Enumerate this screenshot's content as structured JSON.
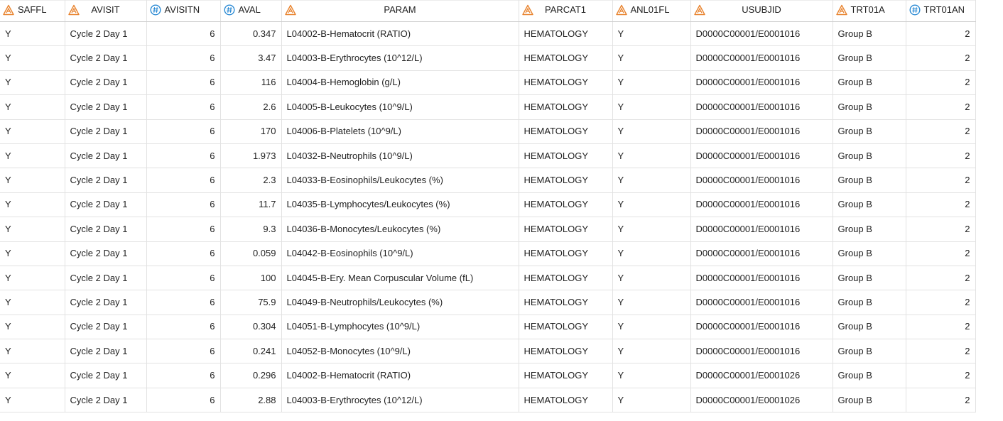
{
  "colors": {
    "char_icon": "#e8832e",
    "num_icon": "#2a8ad4",
    "grid_line": "#e2e2e2"
  },
  "columns": [
    {
      "key": "SAFFL",
      "label": "SAFFL",
      "type": "char",
      "icon": "character-type-icon"
    },
    {
      "key": "AVISIT",
      "label": "AVISIT",
      "type": "char",
      "icon": "character-type-icon"
    },
    {
      "key": "AVISITN",
      "label": "AVISITN",
      "type": "num",
      "icon": "numeric-type-icon"
    },
    {
      "key": "AVAL",
      "label": "AVAL",
      "type": "num",
      "icon": "numeric-type-icon"
    },
    {
      "key": "PARAM",
      "label": "PARAM",
      "type": "char",
      "icon": "character-type-icon"
    },
    {
      "key": "PARCAT1",
      "label": "PARCAT1",
      "type": "char",
      "icon": "character-type-icon"
    },
    {
      "key": "ANL01FL",
      "label": "ANL01FL",
      "type": "char",
      "icon": "character-type-icon"
    },
    {
      "key": "USUBJID",
      "label": "USUBJID",
      "type": "char",
      "icon": "character-type-icon"
    },
    {
      "key": "TRT01A",
      "label": "TRT01A",
      "type": "char",
      "icon": "character-type-icon"
    },
    {
      "key": "TRT01AN",
      "label": "TRT01AN",
      "type": "num",
      "icon": "numeric-type-icon"
    }
  ],
  "rows": [
    [
      "Y",
      "Cycle 2 Day 1",
      "6",
      "0.347",
      "L04002-B-Hematocrit (RATIO)",
      "HEMATOLOGY",
      "Y",
      "D0000C00001/E0001016",
      "Group B",
      "2"
    ],
    [
      "Y",
      "Cycle 2 Day 1",
      "6",
      "3.47",
      "L04003-B-Erythrocytes (10^12/L)",
      "HEMATOLOGY",
      "Y",
      "D0000C00001/E0001016",
      "Group B",
      "2"
    ],
    [
      "Y",
      "Cycle 2 Day 1",
      "6",
      "116",
      "L04004-B-Hemoglobin (g/L)",
      "HEMATOLOGY",
      "Y",
      "D0000C00001/E0001016",
      "Group B",
      "2"
    ],
    [
      "Y",
      "Cycle 2 Day 1",
      "6",
      "2.6",
      "L04005-B-Leukocytes (10^9/L)",
      "HEMATOLOGY",
      "Y",
      "D0000C00001/E0001016",
      "Group B",
      "2"
    ],
    [
      "Y",
      "Cycle 2 Day 1",
      "6",
      "170",
      "L04006-B-Platelets (10^9/L)",
      "HEMATOLOGY",
      "Y",
      "D0000C00001/E0001016",
      "Group B",
      "2"
    ],
    [
      "Y",
      "Cycle 2 Day 1",
      "6",
      "1.973",
      "L04032-B-Neutrophils (10^9/L)",
      "HEMATOLOGY",
      "Y",
      "D0000C00001/E0001016",
      "Group B",
      "2"
    ],
    [
      "Y",
      "Cycle 2 Day 1",
      "6",
      "2.3",
      "L04033-B-Eosinophils/Leukocytes (%)",
      "HEMATOLOGY",
      "Y",
      "D0000C00001/E0001016",
      "Group B",
      "2"
    ],
    [
      "Y",
      "Cycle 2 Day 1",
      "6",
      "11.7",
      "L04035-B-Lymphocytes/Leukocytes (%)",
      "HEMATOLOGY",
      "Y",
      "D0000C00001/E0001016",
      "Group B",
      "2"
    ],
    [
      "Y",
      "Cycle 2 Day 1",
      "6",
      "9.3",
      "L04036-B-Monocytes/Leukocytes (%)",
      "HEMATOLOGY",
      "Y",
      "D0000C00001/E0001016",
      "Group B",
      "2"
    ],
    [
      "Y",
      "Cycle 2 Day 1",
      "6",
      "0.059",
      "L04042-B-Eosinophils (10^9/L)",
      "HEMATOLOGY",
      "Y",
      "D0000C00001/E0001016",
      "Group B",
      "2"
    ],
    [
      "Y",
      "Cycle 2 Day 1",
      "6",
      "100",
      "L04045-B-Ery. Mean Corpuscular Volume (fL)",
      "HEMATOLOGY",
      "Y",
      "D0000C00001/E0001016",
      "Group B",
      "2"
    ],
    [
      "Y",
      "Cycle 2 Day 1",
      "6",
      "75.9",
      "L04049-B-Neutrophils/Leukocytes (%)",
      "HEMATOLOGY",
      "Y",
      "D0000C00001/E0001016",
      "Group B",
      "2"
    ],
    [
      "Y",
      "Cycle 2 Day 1",
      "6",
      "0.304",
      "L04051-B-Lymphocytes (10^9/L)",
      "HEMATOLOGY",
      "Y",
      "D0000C00001/E0001016",
      "Group B",
      "2"
    ],
    [
      "Y",
      "Cycle 2 Day 1",
      "6",
      "0.241",
      "L04052-B-Monocytes (10^9/L)",
      "HEMATOLOGY",
      "Y",
      "D0000C00001/E0001016",
      "Group B",
      "2"
    ],
    [
      "Y",
      "Cycle 2 Day 1",
      "6",
      "0.296",
      "L04002-B-Hematocrit (RATIO)",
      "HEMATOLOGY",
      "Y",
      "D0000C00001/E0001026",
      "Group B",
      "2"
    ],
    [
      "Y",
      "Cycle 2 Day 1",
      "6",
      "2.88",
      "L04003-B-Erythrocytes (10^12/L)",
      "HEMATOLOGY",
      "Y",
      "D0000C00001/E0001026",
      "Group B",
      "2"
    ]
  ]
}
